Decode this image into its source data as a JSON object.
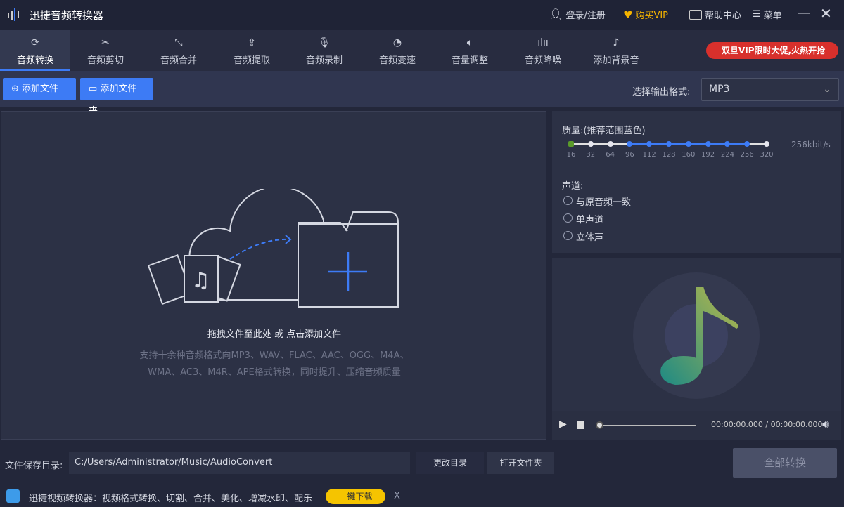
{
  "app": {
    "title": "迅捷音频转换器"
  },
  "header": {
    "login": "登录/注册",
    "buy_vip": "购买VIP",
    "help": "帮助中心",
    "menu": "菜单"
  },
  "nav": {
    "tabs": [
      {
        "label": "音频转换",
        "icon": "refresh-icon"
      },
      {
        "label": "音频剪切",
        "icon": "scissors-icon"
      },
      {
        "label": "音频合并",
        "icon": "merge-icon"
      },
      {
        "label": "音频提取",
        "icon": "extract-icon"
      },
      {
        "label": "音频录制",
        "icon": "microphone-icon"
      },
      {
        "label": "音频变速",
        "icon": "speed-icon"
      },
      {
        "label": "音量调整",
        "icon": "volume-icon"
      },
      {
        "label": "音频降噪",
        "icon": "waveform-icon"
      },
      {
        "label": "添加背景音",
        "icon": "music-note-icon"
      }
    ],
    "promo": "双旦VIP限时大促,火热开抢"
  },
  "toolbar": {
    "add_file": "添加文件",
    "add_folder": "添加文件夹",
    "format_label": "选择输出格式:",
    "format_value": "MP3"
  },
  "dropzone": {
    "title": "拖拽文件至此处 或 点击添加文件",
    "desc1": "支持十余种音频格式向MP3、WAV、FLAC、AAC、OGG、M4A、",
    "desc2": "WMA、AC3、M4R、APE格式转换，同时提升、压缩音频质量"
  },
  "quality": {
    "label": "质量:(推荐范围蓝色)",
    "ticks": [
      "16",
      "32",
      "64",
      "96",
      "112",
      "128",
      "160",
      "192",
      "224",
      "256",
      "320"
    ],
    "selected_index": 9,
    "recommended_range": [
      3,
      9
    ],
    "value_text": "256kbit/s"
  },
  "channel": {
    "label": "声道:",
    "options": [
      "与原音频一致",
      "单声道",
      "立体声"
    ]
  },
  "player": {
    "time": "00:00:00.000 / 00:00:00.000",
    "progress": 0
  },
  "footer": {
    "save_label": "文件保存目录:",
    "save_path": "C:/Users/Administrator/Music/AudioConvert",
    "change_dir": "更改目录",
    "open_folder": "打开文件夹",
    "convert_all": "全部转换"
  },
  "ad": {
    "text": "迅捷视频转换器：视频格式转换、切割、合并、美化、增减水印、配乐",
    "download": "一键下载",
    "close": "X"
  },
  "colors": {
    "accent": "#3d7bf5",
    "vip": "#f5b400"
  }
}
